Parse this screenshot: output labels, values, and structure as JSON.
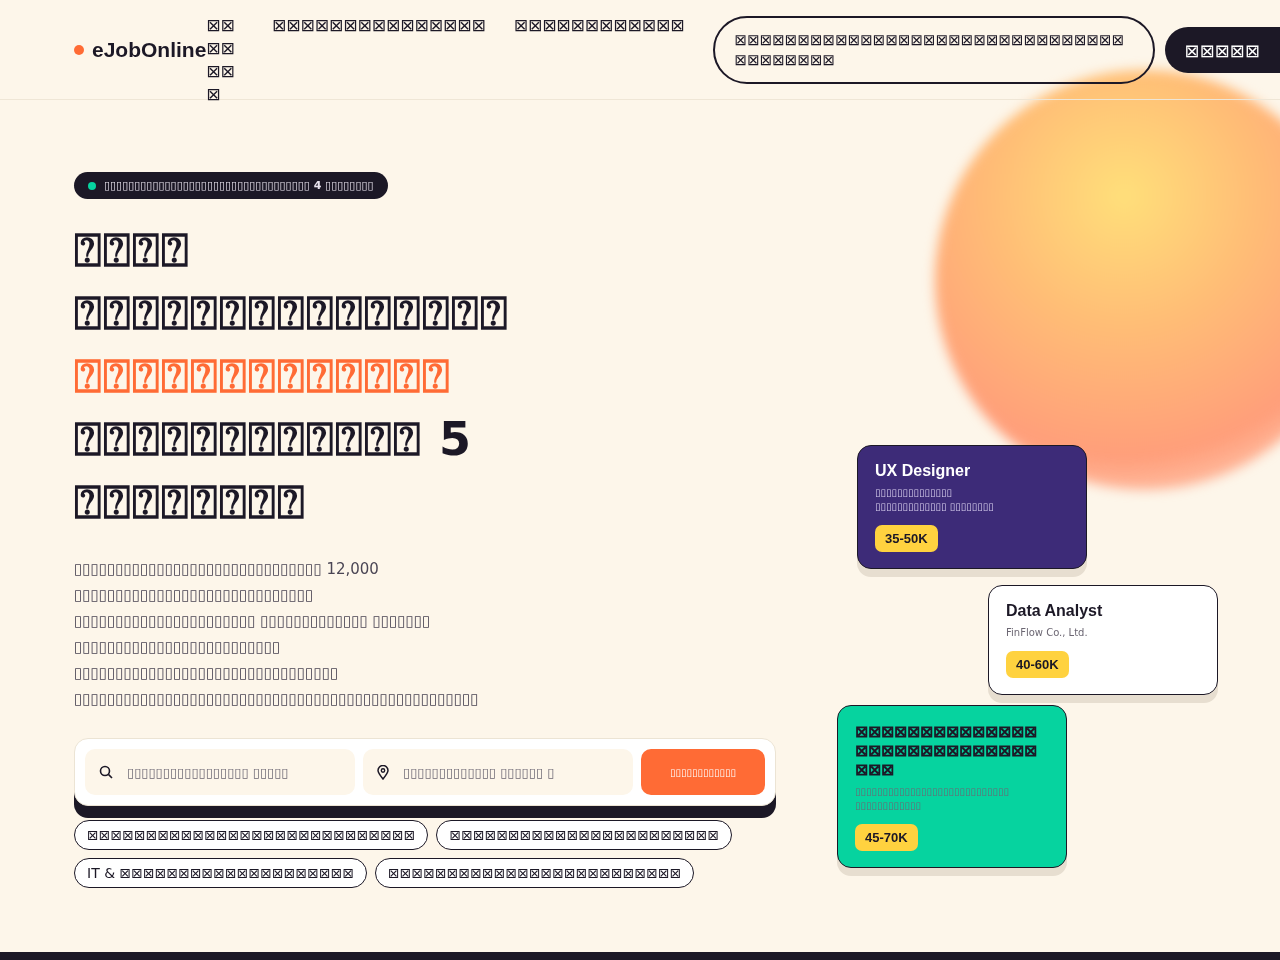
{
  "header": {
    "logo": "eJobOnline",
    "nav": [
      "⊠⊠⊠⊠⊠⊠⊠",
      "⊠⊠⊠⊠⊠⊠⊠⊠⊠⊠⊠⊠⊠⊠⊠",
      "⊠⊠⊠⊠⊠⊠⊠⊠⊠⊠⊠⊠"
    ],
    "outline_button": "⊠⊠⊠⊠⊠⊠⊠⊠⊠⊠⊠⊠⊠⊠⊠⊠⊠⊠⊠⊠⊠⊠⊠⊠⊠⊠⊠⊠⊠⊠⊠⊠⊠⊠⊠⊠⊠⊠⊠",
    "dark_button": "⊠⊠⊠⊠⊠"
  },
  "badge": "▯▯▯▯▯▯▯▯▯▯▯▯▯▯▯▯▯▯▯▯▯▯▯▯▯▯▯▯▯▯▯▯▯▯ 4 ▯▯▯▯▯▯▯▯",
  "headline": [
    {
      "text": "⍰⍰⍰⍰",
      "accent": false
    },
    {
      "text": "⍰⍰⍰⍰⍰⍰⍰⍰⍰⍰⍰⍰⍰⍰⍰",
      "accent": false
    },
    {
      "text": "⍰⍰⍰⍰⍰⍰⍰⍰⍰⍰⍰⍰⍰",
      "accent": true
    },
    {
      "text": "⍰⍰⍰⍰⍰⍰⍰⍰⍰⍰⍰⍰ 5",
      "accent": false
    },
    {
      "text": "⍰⍰⍰⍰⍰⍰⍰⍰",
      "accent": false
    }
  ],
  "description": "▯▯▯▯▯▯▯▯▯▯▯▯▯▯▯▯▯▯▯▯▯▯▯▯▯▯▯▯▯▯ 12,000\n▯▯▯▯▯▯▯▯▯▯▯▯▯▯▯▯▯▯▯▯▯▯▯▯▯▯▯▯▯\n▯▯▯▯▯▯▯▯▯▯▯▯▯▯▯▯▯▯▯▯▯▯ ▯▯▯▯▯▯▯▯▯▯▯▯▯ ▯▯▯▯▯▯▯\n▯▯▯▯▯▯▯▯▯▯▯▯▯▯▯▯▯▯▯▯▯▯▯▯▯\n▯▯▯▯▯▯▯▯▯▯▯▯▯▯▯▯▯▯▯▯▯▯▯▯▯▯▯▯▯▯▯▯\n▯▯▯▯▯▯▯▯▯▯▯▯▯▯▯▯▯▯▯▯▯▯▯▯▯▯▯▯▯▯▯▯▯▯▯▯▯▯▯▯▯▯▯▯▯▯▯▯▯",
  "search": {
    "keyword_placeholder": "▯▯▯▯▯▯▯▯▯▯▯▯▯▯▯▯▯ ▯▯▯▯▯",
    "location_placeholder": "▯▯▯▯▯▯▯▯▯▯▯▯▯ ▯▯▯▯▯▯ ▯",
    "button": "▯▯▯▯▯▯▯▯▯▯▯▯"
  },
  "tags": [
    "⊠⊠⊠⊠⊠⊠⊠⊠⊠⊠⊠⊠⊠⊠⊠⊠⊠⊠⊠⊠⊠⊠⊠⊠⊠⊠⊠⊠",
    "⊠⊠⊠⊠⊠⊠⊠⊠⊠⊠⊠⊠⊠⊠⊠⊠⊠⊠⊠⊠⊠⊠⊠",
    "IT & ⊠⊠⊠⊠⊠⊠⊠⊠⊠⊠⊠⊠⊠⊠⊠⊠⊠⊠⊠⊠",
    "⊠⊠⊠⊠⊠⊠⊠⊠⊠⊠⊠⊠⊠⊠⊠⊠⊠⊠⊠⊠⊠⊠⊠⊠⊠"
  ],
  "job_cards": [
    {
      "title": "UX Designer",
      "company": "▯▯▯▯▯▯▯▯▯▯▯▯▯▯",
      "location": "▯▯▯▯▯▯▯▯▯▯▯▯▯ ▯▯▯▯▯▯▯▯",
      "salary": "35-50K",
      "color": "#3d2b78"
    },
    {
      "title": "Data Analyst",
      "company": "FinFlow Co., Ltd.",
      "salary": "40-60K",
      "color": "#ffffff"
    },
    {
      "title": "⊠⊠⊠⊠⊠⊠⊠⊠⊠⊠⊠⊠⊠⊠⊠⊠⊠⊠⊠⊠⊠⊠⊠⊠⊠⊠⊠⊠⊠⊠⊠",
      "company": "▯▯▯▯▯▯▯▯▯▯▯▯▯▯▯▯▯▯▯▯▯▯▯▯▯▯▯▯",
      "location": "▯▯▯▯▯▯▯▯▯▯▯▯",
      "salary": "45-70K",
      "color": "#06d39f"
    }
  ]
}
